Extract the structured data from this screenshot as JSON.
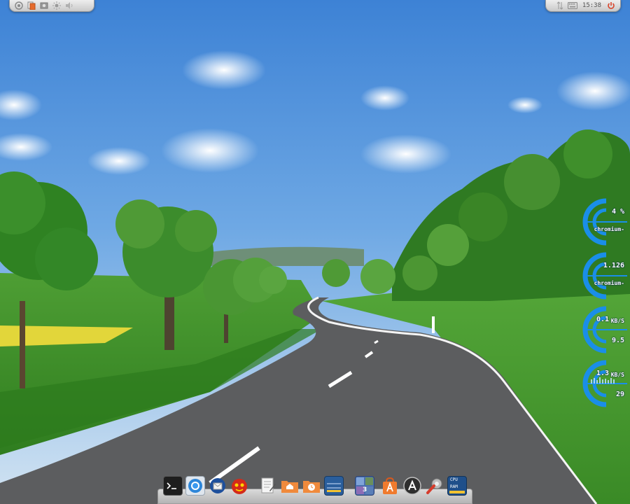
{
  "top_left_panel": {
    "icons": [
      "settings-icon",
      "files-icon",
      "screenshot-icon",
      "brightness-icon",
      "volume-icon"
    ]
  },
  "top_right_panel": {
    "icons": [
      "network-icon",
      "keyboard-icon",
      "power-icon"
    ],
    "clock": "15:38"
  },
  "conky": {
    "cpu": {
      "value": "4 %",
      "process": "chromium-",
      "level": 0.04
    },
    "memory": {
      "value": "1.126",
      "process": "chromium-"
    },
    "network_down": {
      "speed": "0.1",
      "unit": "KB/S",
      "total": "9.5"
    },
    "network_up": {
      "speed": "1.3",
      "unit": "KB/S",
      "total": "29"
    }
  },
  "dock": {
    "items": [
      "terminal-icon",
      "chromium-icon",
      "thunderbird-icon",
      "game-icon",
      "text-editor-icon",
      "home-folder-icon",
      "recent-folder-icon",
      "monitor-widget-icon",
      "workspace-switcher-icon",
      "software-center-icon",
      "app-launcher-icon",
      "system-settings-icon",
      "cpu-ram-widget-icon"
    ],
    "workspace_number": "3",
    "cpu_label": "CPU",
    "ram_label": "RAM"
  },
  "colors": {
    "sky_top": "#3f84d6",
    "sky_bottom": "#d8e7f5",
    "grass": "#3f9a2b",
    "road": "#5c5d5f",
    "conky_blue": "#1a8ee8"
  }
}
